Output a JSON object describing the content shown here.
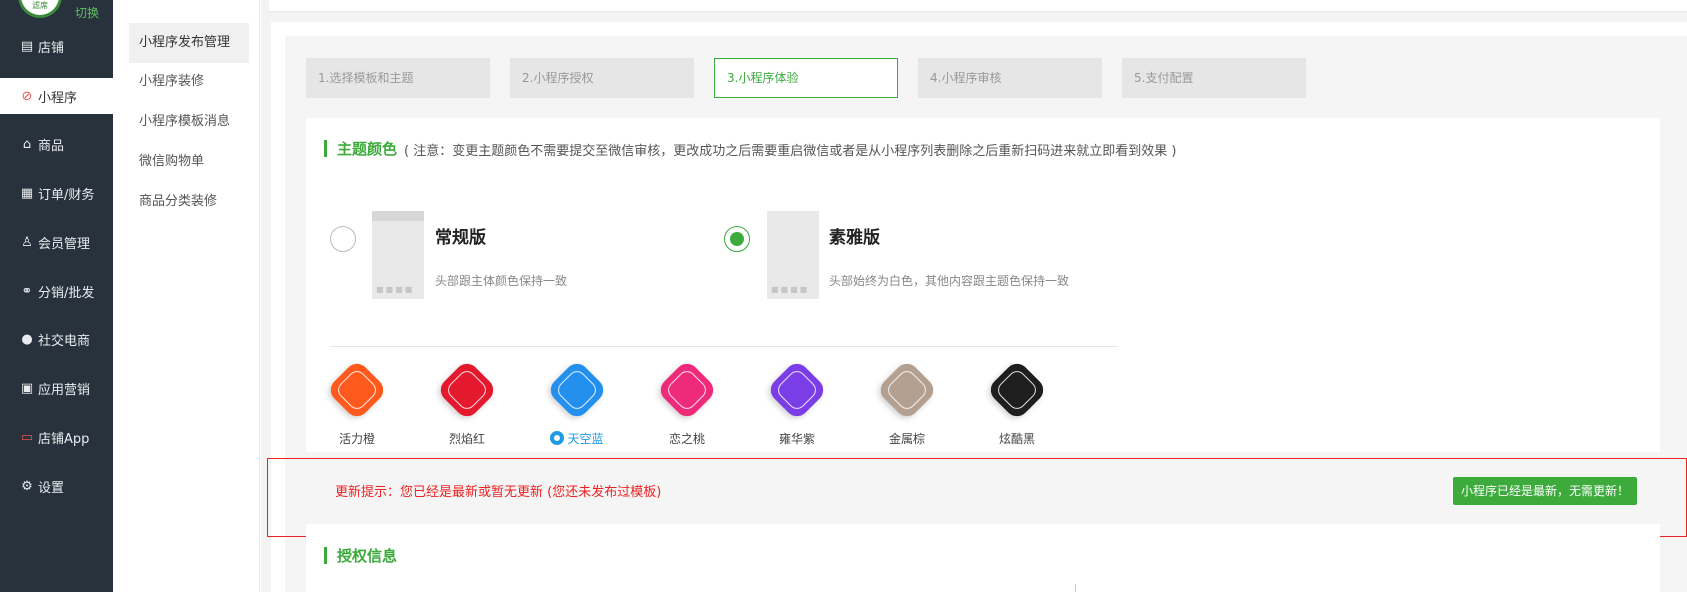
{
  "sidebar": {
    "logo_text": "滤席",
    "switch_label": "切换",
    "items": [
      {
        "label": "店铺",
        "icon": "store-icon"
      },
      {
        "label": "小程序",
        "icon": "link-icon"
      },
      {
        "label": "商品",
        "icon": "bag-icon"
      },
      {
        "label": "订单/财务",
        "icon": "clipboard-icon"
      },
      {
        "label": "会员管理",
        "icon": "users-icon"
      },
      {
        "label": "分销/批发",
        "icon": "share-icon"
      },
      {
        "label": "社交电商",
        "icon": "chat-icon"
      },
      {
        "label": "应用营销",
        "icon": "apps-icon"
      },
      {
        "label": "店铺App",
        "icon": "shop-app-icon"
      },
      {
        "label": "设置",
        "icon": "gear-icon"
      }
    ]
  },
  "submenu": {
    "items": [
      {
        "label": "小程序发布管理"
      },
      {
        "label": "小程序装修"
      },
      {
        "label": "小程序模板消息"
      },
      {
        "label": "微信购物单"
      },
      {
        "label": "商品分类装修"
      }
    ]
  },
  "steps": [
    {
      "label": "1.选择模板和主题"
    },
    {
      "label": "2.小程序授权"
    },
    {
      "label": "3.小程序体验"
    },
    {
      "label": "4.小程序审核"
    },
    {
      "label": "5.支付配置"
    }
  ],
  "theme_section": {
    "title": "主题颜色",
    "note": "( 注意：变更主题颜色不需要提交至微信审核，更改成功之后需要重启微信或者是从小程序列表删除之后重新扫码进来就立即看到效果 )"
  },
  "versions": [
    {
      "title": "常规版",
      "desc": "头部跟主体颜色保持一致",
      "selected": false
    },
    {
      "title": "素雅版",
      "desc": "头部始终为白色，其他内容跟主题色保持一致",
      "selected": true
    }
  ],
  "swatches": [
    {
      "label": "活力橙",
      "color": "#ff5a1e",
      "selected": false
    },
    {
      "label": "烈焰红",
      "color": "#e5192d",
      "selected": false
    },
    {
      "label": "天空蓝",
      "color": "#2490ee",
      "selected": true
    },
    {
      "label": "恋之桃",
      "color": "#ee2a7b",
      "selected": false
    },
    {
      "label": "雍华紫",
      "color": "#7b3ee6",
      "selected": false
    },
    {
      "label": "金属棕",
      "color": "#b4a090",
      "selected": false
    },
    {
      "label": "炫酷黑",
      "color": "#1e1e1e",
      "selected": false
    }
  ],
  "notice": {
    "text": "更新提示：您已经是最新或暂无更新    (您还未发布过模板)",
    "button_label": "小程序已经是最新，无需更新！"
  },
  "auth_section": {
    "title": "授权信息"
  },
  "colors": {
    "accent_green": "#3cab3c",
    "sidebar_bg": "#28323d",
    "notice_red": "#e22222",
    "selected_blue": "#1e9be4"
  }
}
